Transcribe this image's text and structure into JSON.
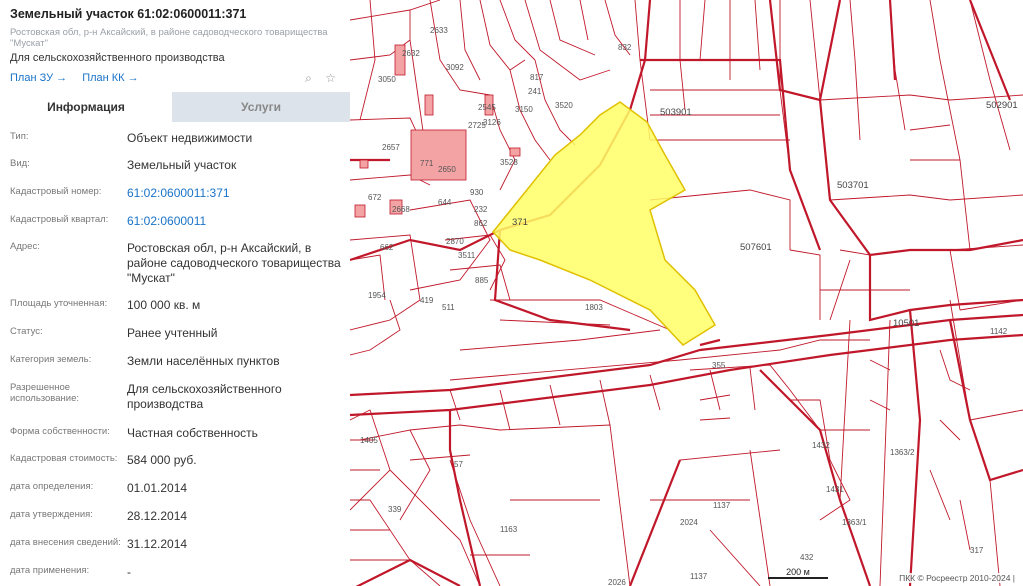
{
  "panel": {
    "title": "Земельный участок 61:02:0600011:371",
    "address_short": "Ростовская обл, р-н Аксайский, в районе садоводческого товарищества \"Мускат\"",
    "use": "Для сельскохозяйственного производства",
    "links": [
      {
        "label": "План ЗУ →"
      },
      {
        "label": "План КК →"
      }
    ],
    "tools": [
      {
        "icon": "zoom-to-object-icon",
        "glyph": "⌕"
      },
      {
        "icon": "star-icon",
        "glyph": "☆"
      }
    ]
  },
  "tabs": [
    {
      "label": "Информация",
      "active": true
    },
    {
      "label": "Услуги",
      "active": false
    }
  ],
  "info": [
    {
      "label": "Тип:",
      "value": "Объект недвижимости"
    },
    {
      "label": "Вид:",
      "value": "Земельный участок"
    },
    {
      "label": "Кадастровый номер:",
      "value": "61:02:0600011:371",
      "link": true
    },
    {
      "label": "Кадастровый квартал:",
      "value": "61:02:0600011",
      "link": true
    },
    {
      "label": "Адрес:",
      "value": "Ростовская обл, р-н Аксайский, в районе садоводческого товарищества \"Мускат\""
    },
    {
      "label": "Площадь уточненная:",
      "value": "100 000 кв. м"
    },
    {
      "label": "Статус:",
      "value": "Ранее учтенный"
    },
    {
      "label": "Категория земель:",
      "value": "Земли населённых пунктов"
    },
    {
      "label": "Разрешенное использование:",
      "value": "Для сельскохозяйственного производства"
    },
    {
      "label": "Форма собственности:",
      "value": "Частная собственность"
    },
    {
      "label": "Кадастровая стоимость:",
      "value": "584 000 руб."
    },
    {
      "label": "дата определения:",
      "value": "01.01.2014"
    },
    {
      "label": "дата утверждения:",
      "value": "28.12.2014"
    },
    {
      "label": "дата внесения сведений:",
      "value": "31.12.2014"
    },
    {
      "label": "дата применения:",
      "value": "-"
    }
  ],
  "map": {
    "colors": {
      "parcel_line": "#c0182a",
      "highlight_fill": "#ffff66",
      "building_fill": "#f3a3a3"
    },
    "selected_parcel_label": "371",
    "quarter_labels": [
      "503901",
      "502901",
      "503701",
      "507601",
      "10501"
    ],
    "parcel_labels": [
      "2633",
      "2632",
      "3050",
      "3092",
      "817",
      "241",
      "3150",
      "3520",
      "832",
      "2545",
      "2725",
      "3126",
      "2657",
      "771",
      "2650",
      "3528",
      "672",
      "2668",
      "644",
      "930",
      "232",
      "862",
      "662",
      "2870",
      "3511",
      "885",
      "1954",
      "419",
      "511",
      "1803",
      "1142",
      "1432",
      "1363/2",
      "1137",
      "1163",
      "2024",
      "432",
      "317",
      "57",
      "339",
      "1405",
      "1431",
      "1363/1",
      "355",
      "1137",
      "2026"
    ],
    "scale_label": "200 м",
    "attribution": "ПКК © Росреестр 2010-2024 |"
  }
}
